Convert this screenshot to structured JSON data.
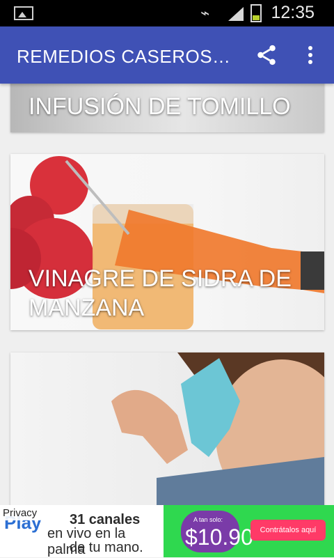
{
  "status_bar": {
    "time": "12:35"
  },
  "app_bar": {
    "title": "REMEDIOS CASEROS…",
    "share_icon": "share-icon",
    "menu_icon": "overflow-menu-icon"
  },
  "cards": [
    {
      "caption": "INFUSIÓN DE TOMILLO"
    },
    {
      "caption": "VINAGRE DE SIDRA DE MANZANA"
    },
    {
      "caption": ""
    }
  ],
  "ad": {
    "privacy": "Privacy",
    "logo": "Play",
    "line1": "31 canales",
    "line2": "en vivo en la palma",
    "line3": "de tu mano.",
    "price_prefix": "A tan solo:",
    "price": "$10.90",
    "cta": "Contrátalos aquí"
  }
}
